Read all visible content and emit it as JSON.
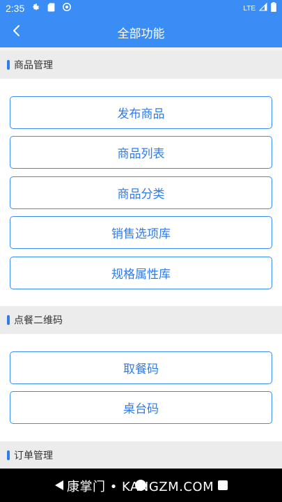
{
  "status_bar": {
    "time": "2:35",
    "network": "LTE",
    "icons": [
      "gear-icon",
      "sd-card-icon",
      "sync-icon",
      "signal-icon",
      "battery-icon"
    ]
  },
  "app_bar": {
    "title": "全部功能",
    "back_icon": "chevron-left-icon"
  },
  "sections": [
    {
      "title": "商品管理",
      "buttons": [
        "发布商品",
        "商品列表",
        "商品分类",
        "销售选项库",
        "规格属性库"
      ]
    },
    {
      "title": "点餐二维码",
      "buttons": [
        "取餐码",
        "桌台码"
      ]
    },
    {
      "title": "订单管理",
      "buttons": []
    }
  ],
  "watermark": "康掌门 • KANGZM.COM",
  "colors": {
    "primary": "#3a8df5",
    "button_text": "#2f7bea",
    "section_bg": "#ececec",
    "nav_bar": "#000000"
  }
}
